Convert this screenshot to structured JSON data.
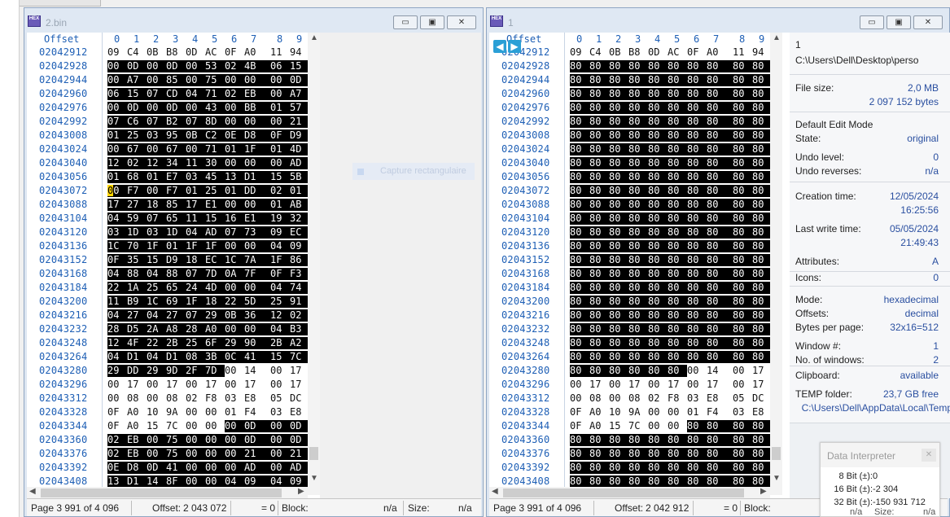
{
  "left_window": {
    "title": "2.bin",
    "logo": "HEX",
    "controls": {
      "minimize": "▭",
      "restore": "▣",
      "close": "✕"
    },
    "column_header": {
      "offset": "Offset",
      "cols": [
        "0",
        "1",
        "2",
        "3",
        "4",
        "5",
        "6",
        "7",
        "8",
        "9"
      ]
    },
    "rows": [
      {
        "off": "02042912",
        "bytes": [
          "09",
          "C4",
          "0B",
          "B8",
          "0D",
          "AC",
          "0F",
          "A0",
          "11",
          "94"
        ],
        "sel_from": 10
      },
      {
        "off": "02042928",
        "bytes": [
          "00",
          "0D",
          "00",
          "0D",
          "00",
          "53",
          "02",
          "4B",
          "06",
          "15"
        ],
        "sel_from": 0
      },
      {
        "off": "02042944",
        "bytes": [
          "00",
          "A7",
          "00",
          "85",
          "00",
          "75",
          "00",
          "00",
          "00",
          "0D"
        ],
        "sel_from": 0
      },
      {
        "off": "02042960",
        "bytes": [
          "06",
          "15",
          "07",
          "CD",
          "04",
          "71",
          "02",
          "EB",
          "00",
          "A7"
        ],
        "sel_from": 0
      },
      {
        "off": "02042976",
        "bytes": [
          "00",
          "0D",
          "00",
          "0D",
          "00",
          "43",
          "00",
          "BB",
          "01",
          "57"
        ],
        "sel_from": 0
      },
      {
        "off": "02042992",
        "bytes": [
          "07",
          "C6",
          "07",
          "B2",
          "07",
          "8D",
          "00",
          "00",
          "00",
          "21"
        ],
        "sel_from": 0
      },
      {
        "off": "02043008",
        "bytes": [
          "01",
          "25",
          "03",
          "95",
          "0B",
          "C2",
          "0E",
          "D8",
          "0F",
          "D9"
        ],
        "sel_from": 0
      },
      {
        "off": "02043024",
        "bytes": [
          "00",
          "67",
          "00",
          "67",
          "00",
          "71",
          "01",
          "1F",
          "01",
          "4D"
        ],
        "sel_from": 0
      },
      {
        "off": "02043040",
        "bytes": [
          "12",
          "02",
          "12",
          "34",
          "11",
          "30",
          "00",
          "00",
          "00",
          "AD"
        ],
        "sel_from": 0
      },
      {
        "off": "02043056",
        "bytes": [
          "01",
          "68",
          "01",
          "E7",
          "03",
          "45",
          "13",
          "D1",
          "15",
          "5B"
        ],
        "sel_from": 0
      },
      {
        "off": "02043072",
        "bytes": [
          "00",
          "F7",
          "00",
          "F7",
          "01",
          "25",
          "01",
          "DD",
          "02",
          "01"
        ],
        "sel_from": 0,
        "cursor": true
      },
      {
        "off": "02043088",
        "bytes": [
          "17",
          "27",
          "18",
          "85",
          "17",
          "E1",
          "00",
          "00",
          "01",
          "AB"
        ],
        "sel_from": 0
      },
      {
        "off": "02043104",
        "bytes": [
          "04",
          "59",
          "07",
          "65",
          "11",
          "15",
          "16",
          "E1",
          "19",
          "32"
        ],
        "sel_from": 0
      },
      {
        "off": "02043120",
        "bytes": [
          "03",
          "1D",
          "03",
          "1D",
          "04",
          "AD",
          "07",
          "73",
          "09",
          "EC"
        ],
        "sel_from": 0
      },
      {
        "off": "02043136",
        "bytes": [
          "1C",
          "70",
          "1F",
          "01",
          "1F",
          "1F",
          "00",
          "00",
          "04",
          "09"
        ],
        "sel_from": 0
      },
      {
        "off": "02043152",
        "bytes": [
          "0F",
          "35",
          "15",
          "D9",
          "18",
          "EC",
          "1C",
          "7A",
          "1F",
          "86"
        ],
        "sel_from": 0
      },
      {
        "off": "02043168",
        "bytes": [
          "04",
          "88",
          "04",
          "88",
          "07",
          "7D",
          "0A",
          "7F",
          "0F",
          "F3"
        ],
        "sel_from": 0
      },
      {
        "off": "02043184",
        "bytes": [
          "22",
          "1A",
          "25",
          "65",
          "24",
          "4D",
          "00",
          "00",
          "04",
          "74"
        ],
        "sel_from": 0
      },
      {
        "off": "02043200",
        "bytes": [
          "11",
          "B9",
          "1C",
          "69",
          "1F",
          "18",
          "22",
          "5D",
          "25",
          "91"
        ],
        "sel_from": 0
      },
      {
        "off": "02043216",
        "bytes": [
          "04",
          "27",
          "04",
          "27",
          "07",
          "29",
          "0B",
          "36",
          "12",
          "02"
        ],
        "sel_from": 0
      },
      {
        "off": "02043232",
        "bytes": [
          "28",
          "D5",
          "2A",
          "A8",
          "28",
          "A0",
          "00",
          "00",
          "04",
          "B3"
        ],
        "sel_from": 0
      },
      {
        "off": "02043248",
        "bytes": [
          "12",
          "4F",
          "22",
          "2B",
          "25",
          "6F",
          "29",
          "90",
          "2B",
          "A2"
        ],
        "sel_from": 0
      },
      {
        "off": "02043264",
        "bytes": [
          "04",
          "D1",
          "04",
          "D1",
          "08",
          "3B",
          "0C",
          "41",
          "15",
          "7C"
        ],
        "sel_from": 0
      },
      {
        "off": "02043280",
        "bytes": [
          "29",
          "DD",
          "29",
          "9D",
          "2F",
          "7D",
          "00",
          "14",
          "00",
          "17"
        ],
        "sel_from": 0,
        "sel_to": 6
      },
      {
        "off": "02043296",
        "bytes": [
          "00",
          "17",
          "00",
          "17",
          "00",
          "17",
          "00",
          "17",
          "00",
          "17"
        ],
        "sel_from": 10
      },
      {
        "off": "02043312",
        "bytes": [
          "00",
          "08",
          "00",
          "08",
          "02",
          "F8",
          "03",
          "E8",
          "05",
          "DC"
        ],
        "sel_from": 10
      },
      {
        "off": "02043328",
        "bytes": [
          "0F",
          "A0",
          "10",
          "9A",
          "00",
          "00",
          "01",
          "F4",
          "03",
          "E8"
        ],
        "sel_from": 10
      },
      {
        "off": "02043344",
        "bytes": [
          "0F",
          "A0",
          "15",
          "7C",
          "00",
          "00",
          "00",
          "0D",
          "00",
          "0D"
        ],
        "sel_from": 6
      },
      {
        "off": "02043360",
        "bytes": [
          "02",
          "EB",
          "00",
          "75",
          "00",
          "00",
          "00",
          "0D",
          "00",
          "0D"
        ],
        "sel_from": 0
      },
      {
        "off": "02043376",
        "bytes": [
          "02",
          "EB",
          "00",
          "75",
          "00",
          "00",
          "00",
          "21",
          "00",
          "21"
        ],
        "sel_from": 0
      },
      {
        "off": "02043392",
        "bytes": [
          "0E",
          "D8",
          "0D",
          "41",
          "00",
          "00",
          "00",
          "AD",
          "00",
          "AD"
        ],
        "sel_from": 0
      },
      {
        "off": "02043408",
        "bytes": [
          "13",
          "D1",
          "14",
          "8F",
          "00",
          "00",
          "04",
          "09",
          "04",
          "09"
        ],
        "sel_from": 0
      }
    ],
    "status": {
      "page": "Page 3 991 of 4 096",
      "offset": "Offset:",
      "offset_val": "2 043 072",
      "eq": "= 0",
      "block": "Block:",
      "block_val": "n/a",
      "size": "Size:",
      "size_val": "n/a"
    }
  },
  "right_window": {
    "title": "1",
    "logo": "HEX",
    "controls": {
      "minimize": "▭",
      "restore": "▣",
      "close": "✕"
    },
    "column_header": {
      "offset": "Offset",
      "cols": [
        "0",
        "1",
        "2",
        "3",
        "4",
        "5",
        "6",
        "7",
        "8",
        "9"
      ]
    },
    "rows": [
      {
        "off": "02042912",
        "bytes": [
          "09",
          "C4",
          "0B",
          "B8",
          "0D",
          "AC",
          "0F",
          "A0",
          "11",
          "94"
        ],
        "sel_from": 10
      },
      {
        "off": "02042928",
        "bytes": [
          "80",
          "80",
          "80",
          "80",
          "80",
          "80",
          "80",
          "80",
          "80",
          "80"
        ],
        "sel_from": 0
      },
      {
        "off": "02042944",
        "bytes": [
          "80",
          "80",
          "80",
          "80",
          "80",
          "80",
          "80",
          "80",
          "80",
          "80"
        ],
        "sel_from": 0
      },
      {
        "off": "02042960",
        "bytes": [
          "80",
          "80",
          "80",
          "80",
          "80",
          "80",
          "80",
          "80",
          "80",
          "80"
        ],
        "sel_from": 0
      },
      {
        "off": "02042976",
        "bytes": [
          "80",
          "80",
          "80",
          "80",
          "80",
          "80",
          "80",
          "80",
          "80",
          "80"
        ],
        "sel_from": 0
      },
      {
        "off": "02042992",
        "bytes": [
          "80",
          "80",
          "80",
          "80",
          "80",
          "80",
          "80",
          "80",
          "80",
          "80"
        ],
        "sel_from": 0
      },
      {
        "off": "02043008",
        "bytes": [
          "80",
          "80",
          "80",
          "80",
          "80",
          "80",
          "80",
          "80",
          "80",
          "80"
        ],
        "sel_from": 0
      },
      {
        "off": "02043024",
        "bytes": [
          "80",
          "80",
          "80",
          "80",
          "80",
          "80",
          "80",
          "80",
          "80",
          "80"
        ],
        "sel_from": 0
      },
      {
        "off": "02043040",
        "bytes": [
          "80",
          "80",
          "80",
          "80",
          "80",
          "80",
          "80",
          "80",
          "80",
          "80"
        ],
        "sel_from": 0
      },
      {
        "off": "02043056",
        "bytes": [
          "80",
          "80",
          "80",
          "80",
          "80",
          "80",
          "80",
          "80",
          "80",
          "80"
        ],
        "sel_from": 0
      },
      {
        "off": "02043072",
        "bytes": [
          "80",
          "80",
          "80",
          "80",
          "80",
          "80",
          "80",
          "80",
          "80",
          "80"
        ],
        "sel_from": 0
      },
      {
        "off": "02043088",
        "bytes": [
          "80",
          "80",
          "80",
          "80",
          "80",
          "80",
          "80",
          "80",
          "80",
          "80"
        ],
        "sel_from": 0
      },
      {
        "off": "02043104",
        "bytes": [
          "80",
          "80",
          "80",
          "80",
          "80",
          "80",
          "80",
          "80",
          "80",
          "80"
        ],
        "sel_from": 0
      },
      {
        "off": "02043120",
        "bytes": [
          "80",
          "80",
          "80",
          "80",
          "80",
          "80",
          "80",
          "80",
          "80",
          "80"
        ],
        "sel_from": 0
      },
      {
        "off": "02043136",
        "bytes": [
          "80",
          "80",
          "80",
          "80",
          "80",
          "80",
          "80",
          "80",
          "80",
          "80"
        ],
        "sel_from": 0
      },
      {
        "off": "02043152",
        "bytes": [
          "80",
          "80",
          "80",
          "80",
          "80",
          "80",
          "80",
          "80",
          "80",
          "80"
        ],
        "sel_from": 0
      },
      {
        "off": "02043168",
        "bytes": [
          "80",
          "80",
          "80",
          "80",
          "80",
          "80",
          "80",
          "80",
          "80",
          "80"
        ],
        "sel_from": 0
      },
      {
        "off": "02043184",
        "bytes": [
          "80",
          "80",
          "80",
          "80",
          "80",
          "80",
          "80",
          "80",
          "80",
          "80"
        ],
        "sel_from": 0
      },
      {
        "off": "02043200",
        "bytes": [
          "80",
          "80",
          "80",
          "80",
          "80",
          "80",
          "80",
          "80",
          "80",
          "80"
        ],
        "sel_from": 0
      },
      {
        "off": "02043216",
        "bytes": [
          "80",
          "80",
          "80",
          "80",
          "80",
          "80",
          "80",
          "80",
          "80",
          "80"
        ],
        "sel_from": 0
      },
      {
        "off": "02043232",
        "bytes": [
          "80",
          "80",
          "80",
          "80",
          "80",
          "80",
          "80",
          "80",
          "80",
          "80"
        ],
        "sel_from": 0
      },
      {
        "off": "02043248",
        "bytes": [
          "80",
          "80",
          "80",
          "80",
          "80",
          "80",
          "80",
          "80",
          "80",
          "80"
        ],
        "sel_from": 0
      },
      {
        "off": "02043264",
        "bytes": [
          "80",
          "80",
          "80",
          "80",
          "80",
          "80",
          "80",
          "80",
          "80",
          "80"
        ],
        "sel_from": 0
      },
      {
        "off": "02043280",
        "bytes": [
          "80",
          "80",
          "80",
          "80",
          "80",
          "80",
          "00",
          "14",
          "00",
          "17"
        ],
        "sel_from": 0,
        "sel_to": 6
      },
      {
        "off": "02043296",
        "bytes": [
          "00",
          "17",
          "00",
          "17",
          "00",
          "17",
          "00",
          "17",
          "00",
          "17"
        ],
        "sel_from": 10
      },
      {
        "off": "02043312",
        "bytes": [
          "00",
          "08",
          "00",
          "08",
          "02",
          "F8",
          "03",
          "E8",
          "05",
          "DC"
        ],
        "sel_from": 10
      },
      {
        "off": "02043328",
        "bytes": [
          "0F",
          "A0",
          "10",
          "9A",
          "00",
          "00",
          "01",
          "F4",
          "03",
          "E8"
        ],
        "sel_from": 10
      },
      {
        "off": "02043344",
        "bytes": [
          "0F",
          "A0",
          "15",
          "7C",
          "00",
          "00",
          "80",
          "80",
          "80",
          "80"
        ],
        "sel_from": 6
      },
      {
        "off": "02043360",
        "bytes": [
          "80",
          "80",
          "80",
          "80",
          "80",
          "80",
          "80",
          "80",
          "80",
          "80"
        ],
        "sel_from": 0
      },
      {
        "off": "02043376",
        "bytes": [
          "80",
          "80",
          "80",
          "80",
          "80",
          "80",
          "80",
          "80",
          "80",
          "80"
        ],
        "sel_from": 0
      },
      {
        "off": "02043392",
        "bytes": [
          "80",
          "80",
          "80",
          "80",
          "80",
          "80",
          "80",
          "80",
          "80",
          "80"
        ],
        "sel_from": 0
      },
      {
        "off": "02043408",
        "bytes": [
          "80",
          "80",
          "80",
          "80",
          "80",
          "80",
          "80",
          "80",
          "80",
          "80"
        ],
        "sel_from": 0
      }
    ],
    "status": {
      "page": "Page 3 991 of 4 096",
      "offset": "Offset:",
      "offset_val": "2 042 912",
      "eq": "= 0",
      "block": "Block:"
    }
  },
  "info": {
    "file_name": "1",
    "file_path": "C:\\Users\\Dell\\Desktop\\perso",
    "file_size_label": "File size:",
    "file_size": "2,0 MB",
    "file_size_bytes": "2 097 152 bytes",
    "edit_mode": "Default Edit Mode",
    "state_label": "State:",
    "state": "original",
    "undo_level_label": "Undo level:",
    "undo_level": "0",
    "undo_rev_label": "Undo reverses:",
    "undo_rev": "n/a",
    "creation_label": "Creation time:",
    "creation_date": "12/05/2024",
    "creation_time": "16:25:56",
    "lastwrite_label": "Last write time:",
    "lastwrite_date": "05/05/2024",
    "lastwrite_time": "21:49:43",
    "attributes_label": "Attributes:",
    "attributes": "A",
    "icons_label": "Icons:",
    "icons": "0",
    "mode_label": "Mode:",
    "mode": "hexadecimal",
    "offsets_label": "Offsets:",
    "offsets": "decimal",
    "bpp_label": "Bytes per page:",
    "bpp": "32x16=512",
    "window_label": "Window #:",
    "window": "1",
    "nwin_label": "No. of windows:",
    "nwin": "2",
    "clipboard_label": "Clipboard:",
    "clipboard": "available",
    "temp_label": "TEMP folder:",
    "temp_free": "23,7 GB free",
    "temp_path": "C:\\Users\\Dell\\AppData\\Local\\Temp"
  },
  "overlay": {
    "text": "Capture rectangulaire"
  },
  "data_interpreter": {
    "title": "Data Interpreter",
    "close": "✕",
    "rows": [
      {
        "label": "8 Bit (±):",
        "value": "0"
      },
      {
        "label": "16 Bit (±):",
        "value": "-2 304"
      },
      {
        "label": "32 Bit (±):",
        "value": "-150 931 712"
      }
    ],
    "partial": {
      "na1": "n/a",
      "size": "Size:",
      "na2": "n/a"
    }
  }
}
